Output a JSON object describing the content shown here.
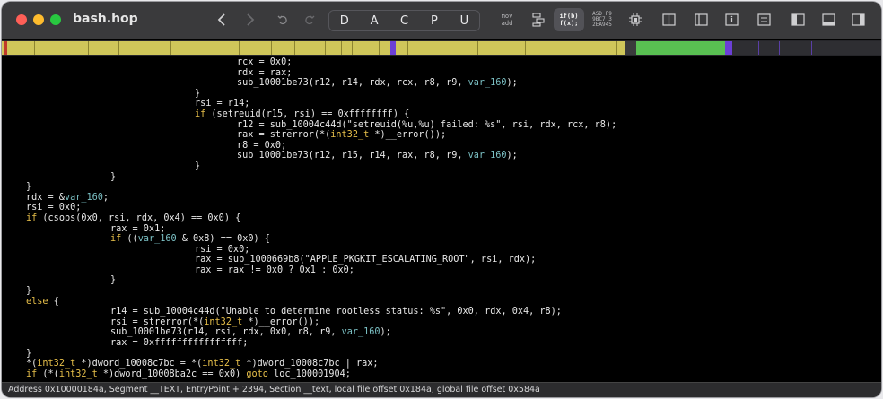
{
  "window": {
    "title": "bash.hop"
  },
  "toolbar": {
    "modes": [
      "D",
      "A",
      "C",
      "P",
      "U"
    ],
    "mov_add_label": [
      "mov",
      "add"
    ],
    "iffx_label": [
      "if(b)",
      "f(x);"
    ],
    "hex_label": [
      "ASD F9",
      "9BC7 3",
      "2EA945"
    ]
  },
  "code_lines": [
    {
      "indent": 5,
      "tokens": [
        [
          "t",
          "rcx = 0x0;"
        ]
      ]
    },
    {
      "indent": 5,
      "tokens": [
        [
          "t",
          "rdx = rax;"
        ]
      ]
    },
    {
      "indent": 5,
      "tokens": [
        [
          "t",
          "sub_10001be73(r12, r14, rdx, rcx, r8, r9, "
        ],
        [
          "v",
          "var_160"
        ],
        [
          "t",
          ");"
        ]
      ]
    },
    {
      "indent": 4,
      "tokens": [
        [
          "t",
          "}"
        ]
      ]
    },
    {
      "indent": 4,
      "tokens": [
        [
          "t",
          "rsi = r14;"
        ]
      ]
    },
    {
      "indent": 4,
      "tokens": [
        [
          "k",
          "if"
        ],
        [
          "t",
          " (setreuid(r15, rsi) == 0xffffffff) {"
        ]
      ]
    },
    {
      "indent": 5,
      "tokens": [
        [
          "t",
          "r12 = sub_10004c44d(\"setreuid(%u,%u) failed: %s\", rsi, rdx, rcx, r8);"
        ]
      ]
    },
    {
      "indent": 5,
      "tokens": [
        [
          "t",
          "rax = strerror(*("
        ],
        [
          "k",
          "int32_t"
        ],
        [
          "t",
          " *)__error());"
        ]
      ]
    },
    {
      "indent": 5,
      "tokens": [
        [
          "t",
          "r8 = 0x0;"
        ]
      ]
    },
    {
      "indent": 5,
      "tokens": [
        [
          "t",
          "sub_10001be73(r12, r15, r14, rax, r8, r9, "
        ],
        [
          "v",
          "var_160"
        ],
        [
          "t",
          ");"
        ]
      ]
    },
    {
      "indent": 4,
      "tokens": [
        [
          "t",
          "}"
        ]
      ]
    },
    {
      "indent": 2,
      "tokens": [
        [
          "t",
          "}"
        ]
      ]
    },
    {
      "indent": 0,
      "tokens": [
        [
          "t",
          "}"
        ]
      ]
    },
    {
      "indent": 0,
      "tokens": [
        [
          "t",
          "rdx = &"
        ],
        [
          "v",
          "var_160"
        ],
        [
          "t",
          ";"
        ]
      ]
    },
    {
      "indent": 0,
      "tokens": [
        [
          "t",
          "rsi = 0x0;"
        ]
      ]
    },
    {
      "indent": 0,
      "tokens": [
        [
          "k",
          "if"
        ],
        [
          "t",
          " (csops(0x0, rsi, rdx, 0x4) == 0x0) {"
        ]
      ]
    },
    {
      "indent": 2,
      "tokens": [
        [
          "t",
          "rax = 0x1;"
        ]
      ]
    },
    {
      "indent": 2,
      "tokens": [
        [
          "k",
          "if"
        ],
        [
          "t",
          " (("
        ],
        [
          "v",
          "var_160"
        ],
        [
          "t",
          " & 0x8) == 0x0) {"
        ]
      ]
    },
    {
      "indent": 4,
      "tokens": [
        [
          "t",
          "rsi = 0x0;"
        ]
      ]
    },
    {
      "indent": 4,
      "tokens": [
        [
          "t",
          "rax = sub_1000669b8(\"APPLE_PKGKIT_ESCALATING_ROOT\", rsi, rdx);"
        ]
      ]
    },
    {
      "indent": 4,
      "tokens": [
        [
          "t",
          "rax = rax != 0x0 ? 0x1 : 0x0;"
        ]
      ]
    },
    {
      "indent": 2,
      "tokens": [
        [
          "t",
          "}"
        ]
      ]
    },
    {
      "indent": 0,
      "tokens": [
        [
          "t",
          "}"
        ]
      ]
    },
    {
      "indent": 0,
      "tokens": [
        [
          "k",
          "else"
        ],
        [
          "t",
          " {"
        ]
      ]
    },
    {
      "indent": 2,
      "tokens": [
        [
          "t",
          "r14 = sub_10004c44d(\"Unable to determine rootless status: %s\", 0x0, rdx, 0x4, r8);"
        ]
      ]
    },
    {
      "indent": 2,
      "tokens": [
        [
          "t",
          "rsi = strerror(*("
        ],
        [
          "k",
          "int32_t"
        ],
        [
          "t",
          " *)__error());"
        ]
      ]
    },
    {
      "indent": 2,
      "tokens": [
        [
          "t",
          "sub_10001be73(r14, rsi, rdx, 0x0, r8, r9, "
        ],
        [
          "v",
          "var_160"
        ],
        [
          "t",
          ");"
        ]
      ]
    },
    {
      "indent": 2,
      "tokens": [
        [
          "t",
          "rax = 0xffffffffffffffff;"
        ]
      ]
    },
    {
      "indent": 0,
      "tokens": [
        [
          "t",
          "}"
        ]
      ]
    },
    {
      "indent": 0,
      "tokens": [
        [
          "t",
          "*("
        ],
        [
          "k",
          "int32_t"
        ],
        [
          "t",
          " *)dword_10008c7bc = *("
        ],
        [
          "k",
          "int32_t"
        ],
        [
          "t",
          " *)dword_10008c7bc | rax;"
        ]
      ]
    },
    {
      "indent": 0,
      "tokens": [
        [
          "k",
          "if"
        ],
        [
          "t",
          " (*("
        ],
        [
          "k",
          "int32_t"
        ],
        [
          "t",
          " *)dword_10008ba2c == 0x0) "
        ],
        [
          "k",
          "goto"
        ],
        [
          "t",
          " loc_100001904;"
        ]
      ]
    }
  ],
  "status": {
    "text": "Address 0x10000184a, Segment __TEXT, EntryPoint + 2394, Section __text, local file offset 0x184a, global file offset 0x584a"
  },
  "colors": {
    "code_bar": "#cfc65a",
    "data_bar": "#59c052",
    "marker": "#6b3fd6",
    "keyword": "#e8c04a",
    "variable": "#7bc0c4"
  }
}
